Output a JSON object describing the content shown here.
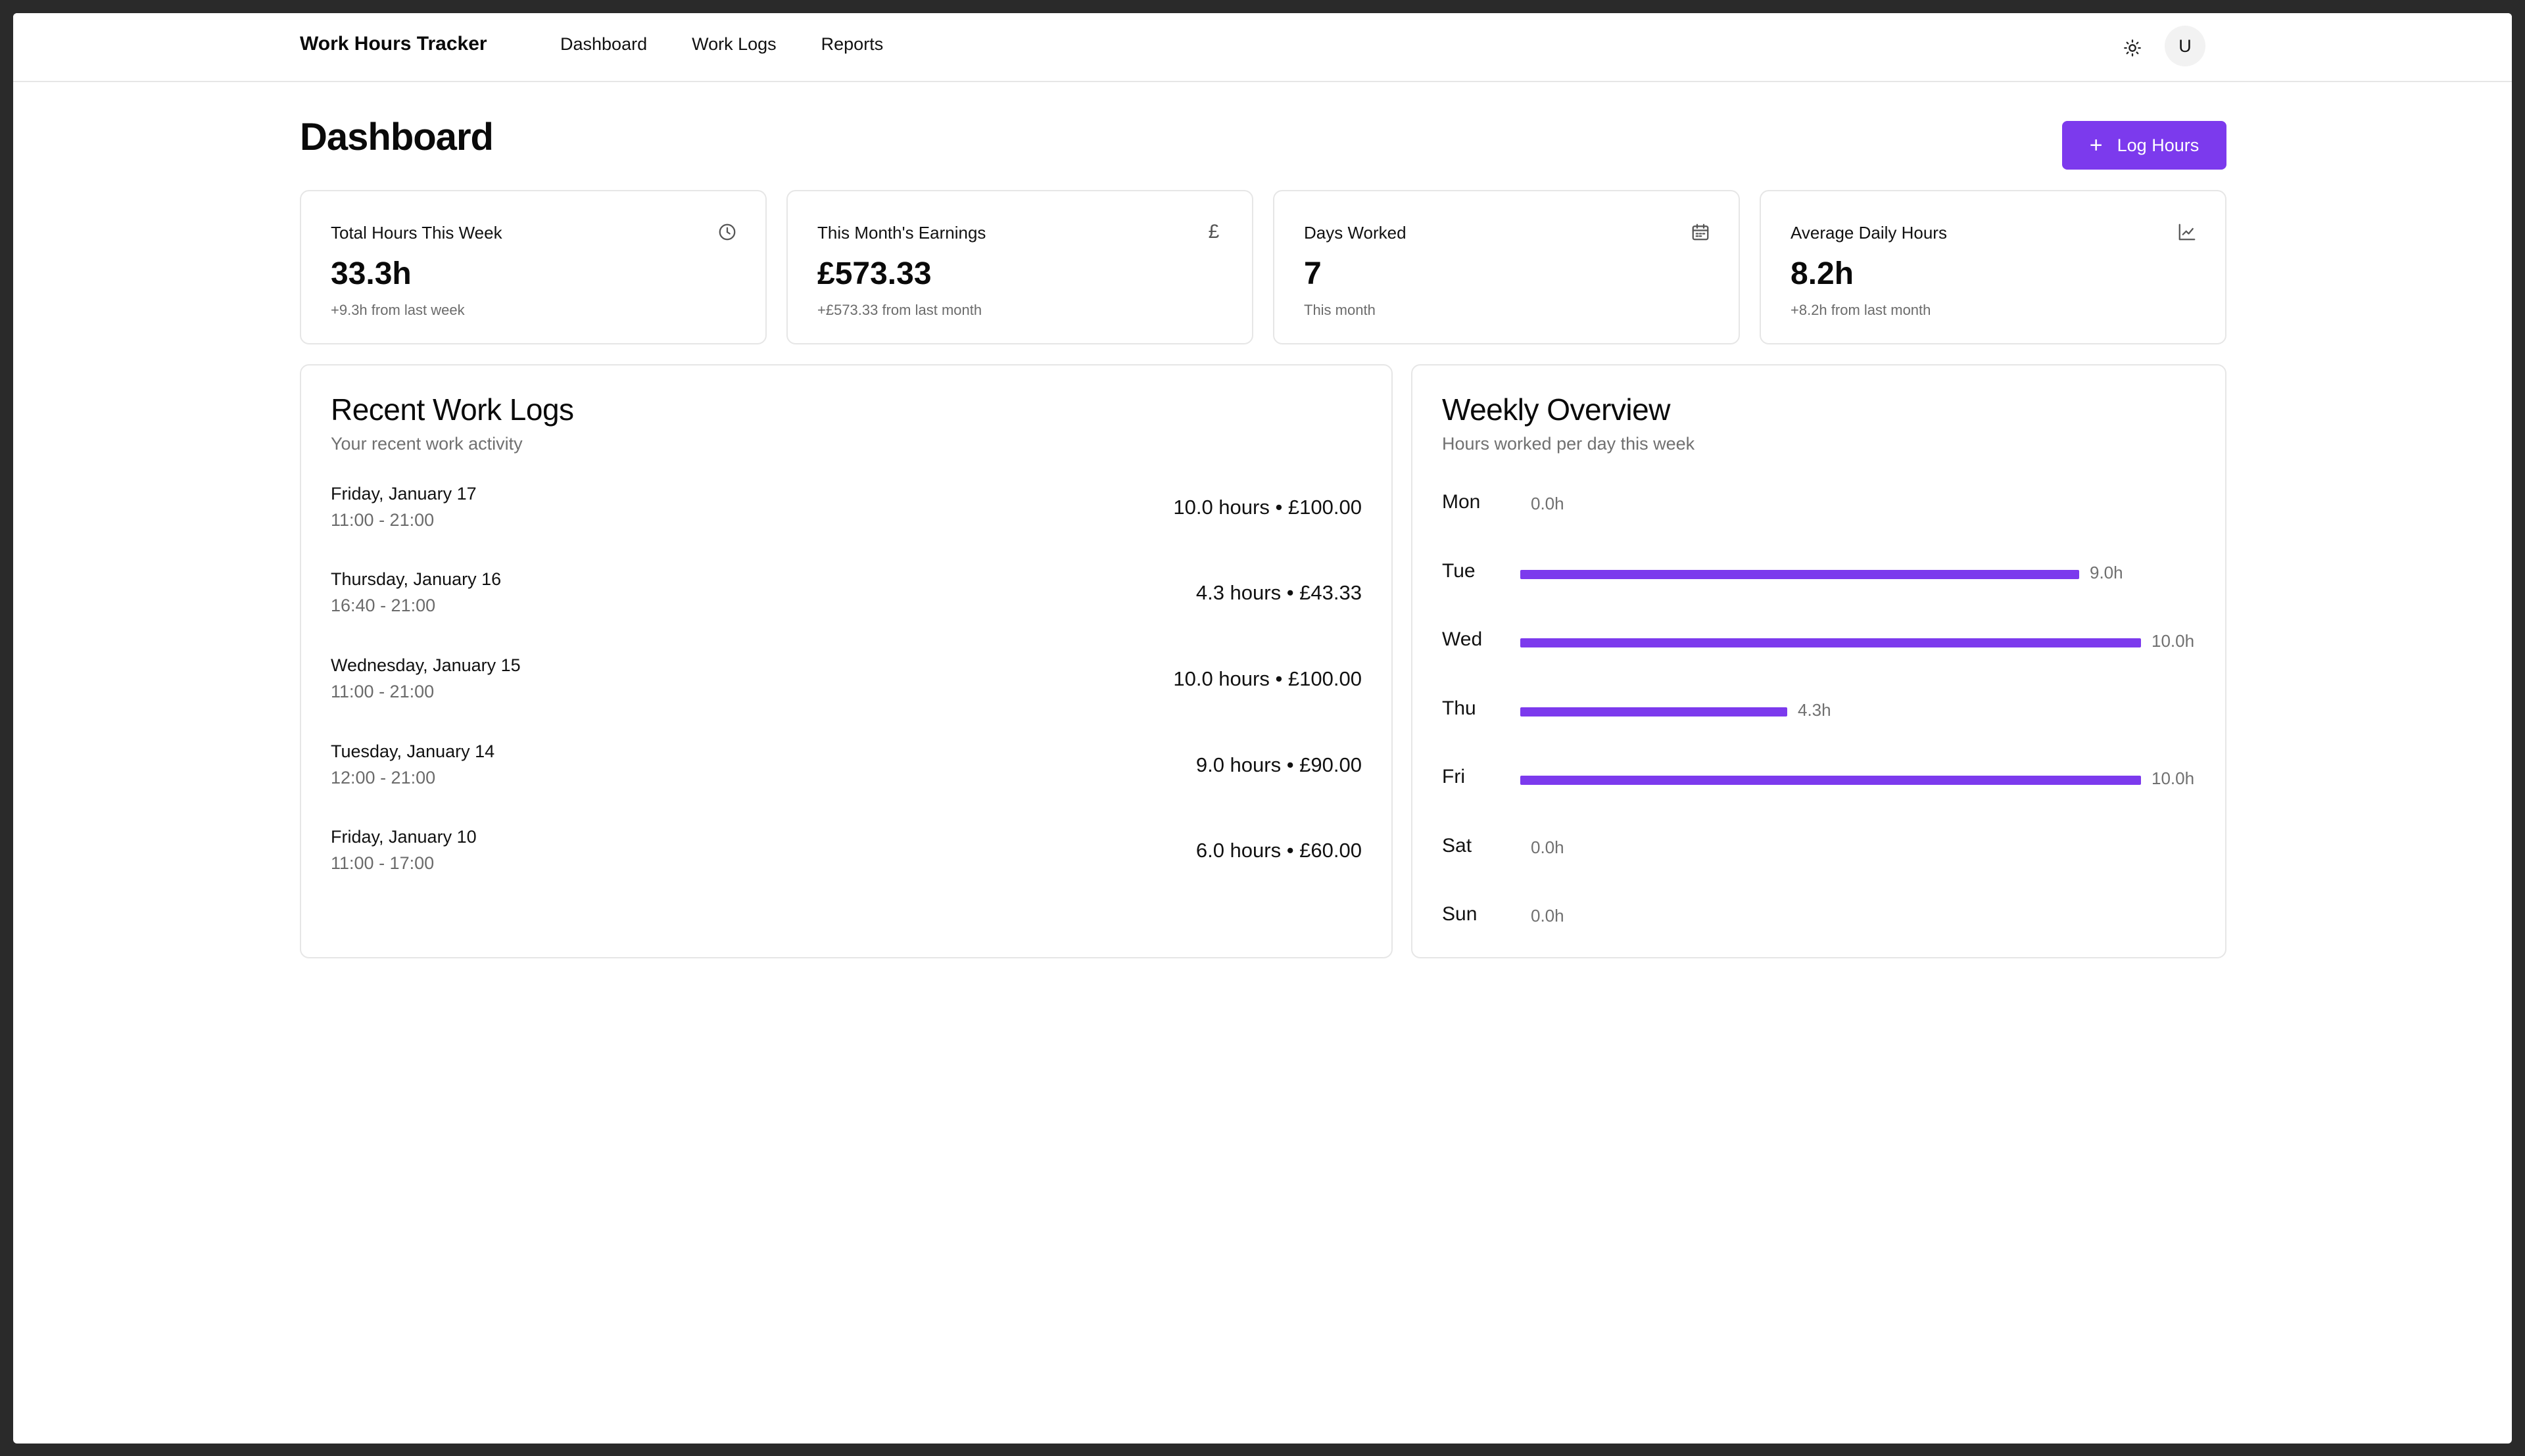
{
  "app": {
    "title": "Work Hours Tracker"
  },
  "nav": {
    "items": [
      "Dashboard",
      "Work Logs",
      "Reports"
    ]
  },
  "user": {
    "initial": "U"
  },
  "icons": {
    "theme": "sun-icon",
    "clock": "clock-icon",
    "pound": "pound-icon",
    "calendar": "calendar-icon",
    "chart": "line-chart-icon",
    "plus": "plus-icon"
  },
  "colors": {
    "accent": "#7c3aed"
  },
  "header": {
    "title": "Dashboard",
    "log_button": "Log Hours"
  },
  "stats": [
    {
      "title": "Total Hours This Week",
      "value": "33.3h",
      "sub": "+9.3h from last week",
      "icon": "clock-icon"
    },
    {
      "title": "This Month's Earnings",
      "value": "£573.33",
      "sub": "+£573.33 from last month",
      "icon": "pound-icon"
    },
    {
      "title": "Days Worked",
      "value": "7",
      "sub": "This month",
      "icon": "calendar-icon"
    },
    {
      "title": "Average Daily Hours",
      "value": "8.2h",
      "sub": "+8.2h from last month",
      "icon": "line-chart-icon"
    }
  ],
  "recent": {
    "title": "Recent Work Logs",
    "subtitle": "Your recent work activity",
    "logs": [
      {
        "date": "Friday, January 17",
        "time": "11:00 - 21:00",
        "amount": "10.0 hours • £100.00"
      },
      {
        "date": "Thursday, January 16",
        "time": "16:40 - 21:00",
        "amount": "4.3 hours • £43.33"
      },
      {
        "date": "Wednesday, January 15",
        "time": "11:00 - 21:00",
        "amount": "10.0 hours • £100.00"
      },
      {
        "date": "Tuesday, January 14",
        "time": "12:00 - 21:00",
        "amount": "9.0 hours • £90.00"
      },
      {
        "date": "Friday, January 10",
        "time": "11:00 - 17:00",
        "amount": "6.0 hours • £60.00"
      }
    ]
  },
  "weekly": {
    "title": "Weekly Overview",
    "subtitle": "Hours worked per day this week"
  },
  "chart_data": {
    "type": "bar",
    "orientation": "horizontal",
    "categories": [
      "Mon",
      "Tue",
      "Wed",
      "Thu",
      "Fri",
      "Sat",
      "Sun"
    ],
    "values": [
      0.0,
      9.0,
      10.0,
      4.3,
      10.0,
      0.0,
      0.0
    ],
    "value_labels": [
      "0.0h",
      "9.0h",
      "10.0h",
      "4.3h",
      "10.0h",
      "0.0h",
      "0.0h"
    ],
    "xlim": [
      0,
      10
    ],
    "color": "#7c3aed"
  }
}
